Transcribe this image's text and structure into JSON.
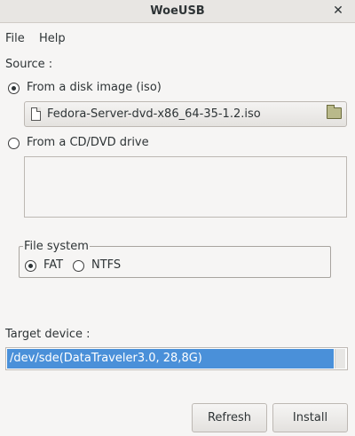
{
  "window": {
    "title": "WoeUSB",
    "close_glyph": "✕"
  },
  "menu": {
    "file": "File",
    "help": "Help"
  },
  "source": {
    "label": "Source :",
    "from_iso": {
      "label": "From a disk image (iso)",
      "selected": true
    },
    "iso_file": {
      "name": "Fedora-Server-dvd-x86_64-35-1.2.iso"
    },
    "from_drive": {
      "label": "From a CD/DVD drive",
      "selected": false
    }
  },
  "filesystem": {
    "legend": "File system",
    "options": [
      {
        "label": "FAT",
        "selected": true
      },
      {
        "label": "NTFS",
        "selected": false
      }
    ]
  },
  "target": {
    "label": "Target device :",
    "selected_device": "/dev/sde(DataTraveler3.0, 28,8G)"
  },
  "buttons": {
    "refresh": "Refresh",
    "install": "Install"
  },
  "colors": {
    "selection": "#4a90d9",
    "background": "#f6f5f4"
  }
}
